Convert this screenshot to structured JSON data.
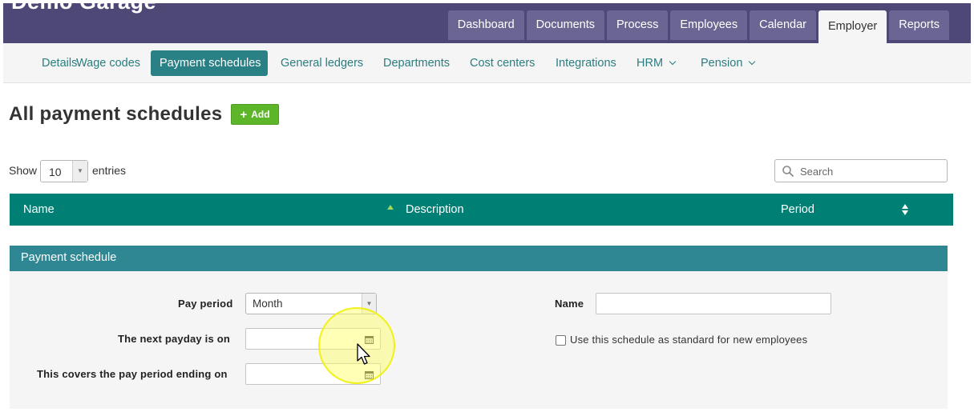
{
  "app": {
    "brand": "Demo Garage"
  },
  "main_tabs": [
    {
      "label": "Dashboard",
      "active": false
    },
    {
      "label": "Documents",
      "active": false
    },
    {
      "label": "Process",
      "active": false
    },
    {
      "label": "Employees",
      "active": false
    },
    {
      "label": "Calendar",
      "active": false
    },
    {
      "label": "Employer",
      "active": true
    },
    {
      "label": "Reports",
      "active": false
    }
  ],
  "sub_nav": [
    {
      "label": "Details",
      "active": false
    },
    {
      "label": "Wage codes",
      "active": false
    },
    {
      "label": "Payment schedules",
      "active": true
    },
    {
      "label": "General ledgers",
      "active": false
    },
    {
      "label": "Departments",
      "active": false
    },
    {
      "label": "Cost centers",
      "active": false
    },
    {
      "label": "Integrations",
      "active": false
    },
    {
      "label": "HRM",
      "active": false,
      "dropdown": true
    },
    {
      "label": "Pension",
      "active": false,
      "dropdown": true
    }
  ],
  "page": {
    "title": "All payment schedules",
    "add_label": "Add"
  },
  "table_controls": {
    "show_label": "Show",
    "entries_value": "10",
    "entries_label": "entries",
    "search_placeholder": "Search"
  },
  "table": {
    "columns": [
      {
        "label": "Name",
        "sort": "ascending"
      },
      {
        "label": "Description",
        "sort": "none"
      },
      {
        "label": "Period",
        "sort": "both"
      }
    ],
    "rows": []
  },
  "form": {
    "panel_title": "Payment schedule",
    "pay_period_label": "Pay period",
    "pay_period_value": "Month",
    "next_payday_label": "The next payday is on",
    "next_payday_value": "",
    "period_ending_label": "This covers the pay period ending on",
    "period_ending_value": "",
    "name_label": "Name",
    "name_value": "",
    "standard_checkbox_label": "Use this schedule as standard for new employees",
    "standard_checked": false
  },
  "colors": {
    "header_bg": "#4e4877",
    "tab_bg": "#6b6593",
    "accent_teal": "#2a8185",
    "table_header": "#007f74",
    "panel_header": "#2e8793",
    "add_green": "#5db52a",
    "click_highlight": "#ffff5a"
  },
  "icons": {
    "add": "plus-icon",
    "search": "search-icon",
    "date": "calendar-icon",
    "dropdown": "chevron-down-icon",
    "pointer": "mouse-cursor-icon"
  }
}
